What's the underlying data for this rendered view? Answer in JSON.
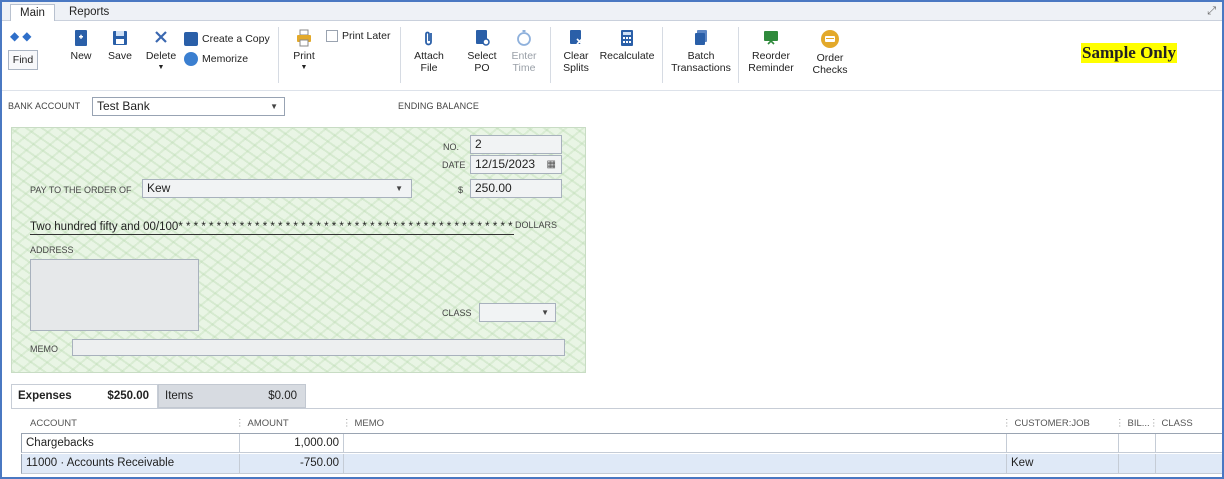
{
  "menu_tabs": [
    "Main",
    "Reports"
  ],
  "toolbar": {
    "find": "Find",
    "new": "New",
    "save": "Save",
    "delete": "Delete",
    "create_copy": "Create a Copy",
    "memorize": "Memorize",
    "print": "Print",
    "print_later": "Print Later",
    "attach_file": [
      "Attach",
      "File"
    ],
    "select_po": [
      "Select",
      "PO"
    ],
    "enter_time": [
      "Enter",
      "Time"
    ],
    "clear_splits": [
      "Clear",
      "Splits"
    ],
    "recalculate": "Recalculate",
    "batch_transactions": [
      "Batch",
      "Transactions"
    ],
    "reorder_reminder": [
      "Reorder",
      "Reminder"
    ],
    "order_checks": [
      "Order",
      "Checks"
    ],
    "sample_only": "Sample Only"
  },
  "bank": {
    "label": "BANK ACCOUNT",
    "value": "Test Bank",
    "ending_balance_label": "ENDING BALANCE"
  },
  "check": {
    "no_label": "NO.",
    "no": "2",
    "date_label": "DATE",
    "date": "12/15/2023",
    "pay_to_label": "PAY TO THE ORDER OF",
    "payee": "Kew",
    "dollar_sign": "$",
    "amount": "250.00",
    "amount_words": "Two hundred fifty and 00/100* * * * * * * * * * * * * * * * * * * * * * * * * * * * * * * * * * * * * * * * * * * * * * * * *",
    "dollars_label": "DOLLARS",
    "address_label": "ADDRESS",
    "class_label": "CLASS",
    "memo_label": "MEMO"
  },
  "subtabs": {
    "expenses_label": "Expenses",
    "expenses_amount": "$250.00",
    "items_label": "Items",
    "items_amount": "$0.00"
  },
  "grid": {
    "headers": {
      "account": "ACCOUNT",
      "amount": "AMOUNT",
      "memo": "MEMO",
      "customer_job": "CUSTOMER:JOB",
      "billable": "BIL...",
      "class": "CLASS"
    },
    "rows": [
      {
        "account": "Chargebacks",
        "amount": "1,000.00",
        "memo": "",
        "customer": "",
        "billable": "",
        "class": ""
      },
      {
        "account": "11000 · Accounts Receivable",
        "amount": "-750.00",
        "memo": "",
        "customer": "Kew",
        "billable": "",
        "class": ""
      }
    ]
  },
  "colors": {
    "accent": "#2f6fc9",
    "check_bg": "#e9f5e5",
    "selected_row": "#dfe9f7",
    "highlight": "#ffff00"
  }
}
